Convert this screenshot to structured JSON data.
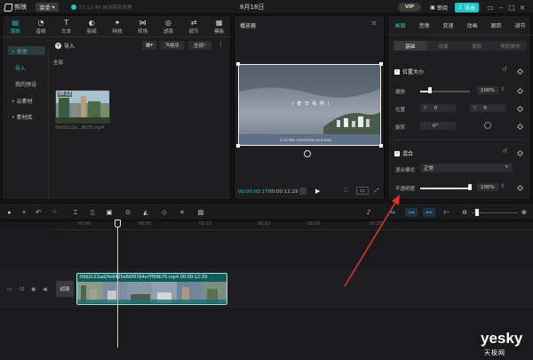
{
  "app": {
    "name": "剪映",
    "menu_label": "菜单",
    "save_status": "17:11:45 自动保存本地",
    "project_title": "8月18日",
    "vip_label": "VIP",
    "review_label": "审阅",
    "export_label": "导出"
  },
  "tools": [
    {
      "label": "媒体",
      "icon": "media-icon"
    },
    {
      "label": "音频",
      "icon": "audio-icon"
    },
    {
      "label": "文本",
      "icon": "text-icon"
    },
    {
      "label": "贴纸",
      "icon": "sticker-icon"
    },
    {
      "label": "特效",
      "icon": "effects-icon"
    },
    {
      "label": "转场",
      "icon": "transition-icon"
    },
    {
      "label": "滤镜",
      "icon": "filter-icon"
    },
    {
      "label": "调节",
      "icon": "adjust-icon"
    },
    {
      "label": "模板",
      "icon": "template-icon"
    }
  ],
  "media": {
    "sidebar": {
      "local": "• 本地",
      "import": "导入",
      "presets": "我的预设",
      "cloud": "• 云素材",
      "library": "• 素材库"
    },
    "import_label": "导入",
    "sort_label": "排序",
    "filter_label": "全部",
    "all_label": "全部",
    "thumb_duration": "00:12",
    "thumb_caption": "09d2c22a...9b76.mp4"
  },
  "player": {
    "title": "播放器",
    "overlay_text": "| 春 日 和 煦 |",
    "overlay_sub": "in to the mountains and seas",
    "current_time": "00:00:03:17",
    "total_time": "00:00:12:29"
  },
  "props": {
    "tabs": [
      "画面",
      "音频",
      "变速",
      "动画",
      "跟踪",
      "调节"
    ],
    "sub_tabs": [
      "基础",
      "抠像",
      "蒙版",
      "美颜美体"
    ],
    "position_size": "位置大小",
    "scale_label": "缩放",
    "scale_value": "100%",
    "scale_fraction": 0.2,
    "position_label": "位置",
    "pos_x_label": "X",
    "pos_x": "0",
    "pos_y_label": "Y",
    "pos_y": "0",
    "rotate_label": "旋转",
    "rotate_value": "0°",
    "blend_label": "混合",
    "blend_mode_label": "混合模式",
    "blend_mode_value": "正常",
    "opacity_label": "不透明度",
    "opacity_value": "100%",
    "opacity_fraction": 1.0
  },
  "timeline": {
    "ticks": [
      "00:00",
      "00:05",
      "00:10",
      "00:15",
      "00:20",
      "00:25"
    ],
    "cover_label": "封面",
    "clip_label": "09d2c22ad2fe9425e66f9764e7ff99b76.mp4  00:00:12:29"
  },
  "watermark": {
    "brand": "yesky",
    "sub": "天极网"
  },
  "colors": {
    "accent": "#20c5c6",
    "annotation_arrow": "#e0302d"
  }
}
